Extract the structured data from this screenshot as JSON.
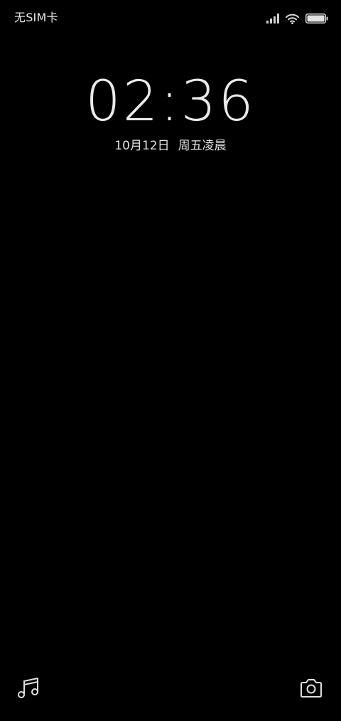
{
  "status_bar": {
    "carrier": "无SIM卡",
    "icons": [
      "signal-icon",
      "wifi-icon",
      "battery-icon"
    ]
  },
  "lock_screen": {
    "time": "02:36",
    "date": "10月12日",
    "weekday": "周五凌晨"
  },
  "shortcuts": {
    "left": "music-icon",
    "right": "camera-icon"
  },
  "colors": {
    "background": "#000000",
    "foreground": "#eaeaea"
  }
}
